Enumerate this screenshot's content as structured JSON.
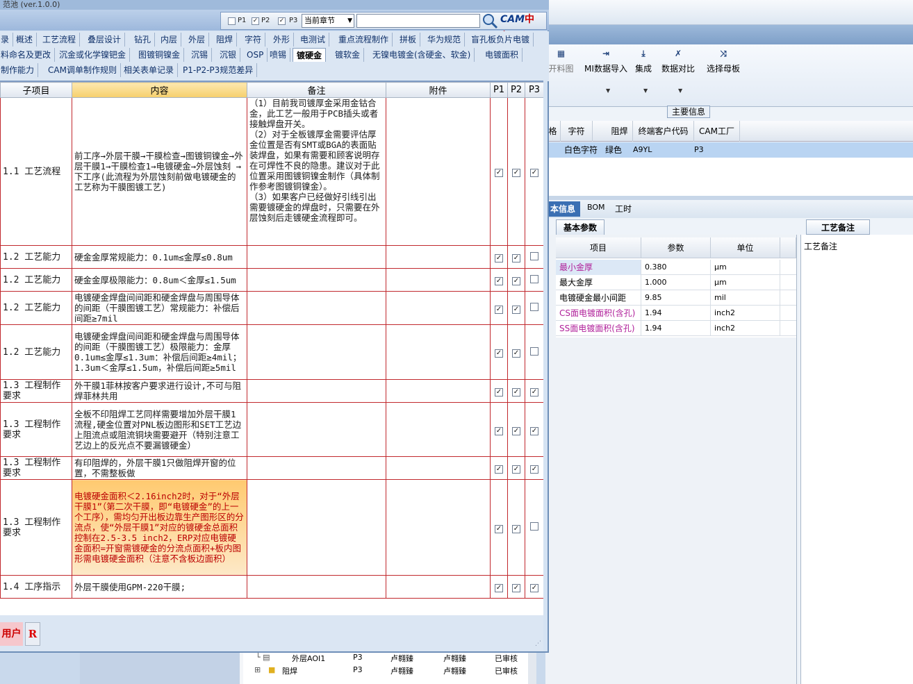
{
  "dialog": {
    "title": "范池 (ver.1.0.0)",
    "filters": [
      {
        "label": "P1",
        "checked": false
      },
      {
        "label": "P2",
        "checked": true
      },
      {
        "label": "P3",
        "checked": true
      }
    ],
    "chapter_select": "当前章节",
    "search_value": "",
    "logo_text": "CAM",
    "logo_suffix": "中心",
    "tab_rows": [
      [
        "录",
        "概述",
        "工艺流程",
        "叠层设计",
        "钻孔",
        "内层",
        "外层",
        "阻焊",
        "字符",
        "外形",
        "电测试",
        "重点流程制作",
        "拼板",
        "华为规范",
        "盲孔板负片电镀"
      ],
      [
        "料命名及更改",
        "沉金或化学镍钯金",
        "图镀铜镍金",
        "沉锡",
        "沉银",
        "OSP",
        "喷锡",
        "镀硬金",
        "镀软金",
        "无镍电镀金(含硬金、软金)",
        "电镀面积"
      ],
      [
        "制作能力",
        "CAM调单制作规则",
        "相关表单记录",
        "P1-P2-P3规范差异"
      ]
    ],
    "active_tab": "镀硬金",
    "table": {
      "headers": [
        "子项目",
        "内容",
        "备注",
        "附件",
        "P1",
        "P2",
        "P3"
      ],
      "rows": [
        {
          "sub": "1.1 工艺流程",
          "content": "前工序→外层干膜→干膜检查→图镀铜镍金→外层干膜1→干膜检查1→电镀硬金→外层蚀刻 →下工序(此流程为外层蚀刻前做电镀硬金的工艺称为干膜图镀工艺)",
          "note": "（1）目前我司镀厚金采用金钴合金，此工艺一般用于PCB插头或者接触焊盘开关。\n（2）对于全板镀厚金需要评估厚金位置是否有SMT或BGA的表面贴装焊盘，如果有需要和顾客说明存在可焊性不良的隐患。建议对于此位置采用图镀铜镍金制作（具体制作参考图镀铜镍金）。\n（3）如果客户已经做好引线引出需要镀硬金的焊盘时，只需要在外层蚀刻后走镀硬金流程即可。",
          "attach": "",
          "p1": true,
          "p2": true,
          "p3": true
        },
        {
          "sub": "1.2 工艺能力",
          "content": "硬金金厚常规能力：0.1um≤金厚≤0.8um",
          "note": "",
          "attach": "",
          "p1": true,
          "p2": true,
          "p3": false
        },
        {
          "sub": "1.2 工艺能力",
          "content": "硬金金厚极限能力：0.8um＜金厚≤1.5um",
          "note": "",
          "attach": "",
          "p1": true,
          "p2": true,
          "p3": false
        },
        {
          "sub": "1.2 工艺能力",
          "content": "电镀硬金焊盘间间距和硬金焊盘与周围导体的间距（干膜图镀工艺）常规能力：补偿后间距≥7mil",
          "note": "",
          "attach": "",
          "p1": true,
          "p2": true,
          "p3": false
        },
        {
          "sub": "1.2 工艺能力",
          "content": "电镀硬金焊盘间间距和硬金焊盘与周围导体的间距（干膜图镀工艺）极限能力：金厚0.1um≤金厚≤1.3um：补偿后间距≥4mil；1.3um＜金厚≤1.5um，补偿后间距≥5mil",
          "note": "",
          "attach": "",
          "p1": true,
          "p2": true,
          "p3": false
        },
        {
          "sub": "1.3 工程制作要求",
          "content": "外干膜1菲林按客户要求进行设计,不可与阻焊菲林共用",
          "note": "",
          "attach": "",
          "p1": true,
          "p2": true,
          "p3": true
        },
        {
          "sub": "1.3 工程制作要求",
          "content": "全板不印阻焊工艺同样需要增加外层干膜1流程,硬金位置对PNL板边图形和SET工艺边上阻流点或阻流铜块需要避开（特别注意工艺边上的反光点不要漏镀硬金）",
          "note": "",
          "attach": "",
          "p1": true,
          "p2": true,
          "p3": true
        },
        {
          "sub": "1.3 工程制作要求",
          "content": "有印阻焊的，外层干膜1只做阻焊开窗的位置，不需整板做",
          "note": "",
          "attach": "",
          "p1": true,
          "p2": true,
          "p3": true
        },
        {
          "sub": "1.3 工程制作要求",
          "content": "电镀硬金面积＜2.16inch2时，对于“外层干膜1”（第二次干膜，即“电镀硬金”的上一个工序），需均匀开出板边靠生产图形区的分流点，使“外层干膜1”对应的镀硬金总面积控制在2.5-3.5 inch2，ERP对应电镀硬金面积=开窗需镀硬金的分流点面积+板内图形需电镀硬金面积（注意不含板边面积）",
          "note": "",
          "attach": "",
          "p1": true,
          "p2": true,
          "p3": false
        },
        {
          "sub": "1.4 工序指示",
          "content": "外层干膜使用GPM-220干膜;",
          "note": "",
          "attach": "",
          "p1": true,
          "p2": true,
          "p3": true
        }
      ]
    },
    "status": {
      "user": "用户",
      "r_label": "R"
    }
  },
  "background": {
    "ribbon": [
      {
        "label": "开料图",
        "icon": "cut-icon",
        "dropdown": false
      },
      {
        "label": "MI数据导入",
        "icon": "import-icon",
        "dropdown": true
      },
      {
        "label": "集成",
        "icon": "integrate-icon",
        "dropdown": true
      },
      {
        "label": "数据对比",
        "icon": "compare-icon",
        "dropdown": true
      },
      {
        "label": "选择母板",
        "icon": "shuffle-icon",
        "dropdown": false
      }
    ],
    "main_info_label": "主要信息",
    "grid_headers": [
      "格",
      "字符",
      "阻焊",
      "终端客户代码",
      "CAM工厂"
    ],
    "grid_row": [
      "",
      "白色字符",
      "绿色",
      "A9YL",
      "P3"
    ],
    "tabs2": [
      "本信息",
      "BOM",
      "工时"
    ],
    "basic_tab": "基本参数",
    "param_headers": [
      "项目",
      "参数",
      "单位"
    ],
    "params": [
      {
        "name": "最小金厚",
        "value": "0.380",
        "unit": "μm",
        "highlight": true
      },
      {
        "name": "最大金厚",
        "value": "1.000",
        "unit": "μm",
        "highlight": false
      },
      {
        "name": "电镀硬金最小间距",
        "value": "9.85",
        "unit": "mil",
        "highlight": false
      },
      {
        "name": "CS面电镀面积(含孔)",
        "value": "1.94",
        "unit": "inch2",
        "highlight": true
      },
      {
        "name": "SS面电镀面积(含孔)",
        "value": "1.94",
        "unit": "inch2",
        "highlight": true
      }
    ],
    "process_tab": "工艺备注",
    "process_label": "工艺备注",
    "bottom_list": [
      {
        "name": "外层AOI1",
        "site": "P3",
        "user1": "卢翱臻",
        "user2": "卢翱臻",
        "status": "已审核"
      },
      {
        "name": "阻焊",
        "site": "P3",
        "user1": "卢翱臻",
        "user2": "卢翱臻",
        "status": "已审核"
      }
    ]
  }
}
